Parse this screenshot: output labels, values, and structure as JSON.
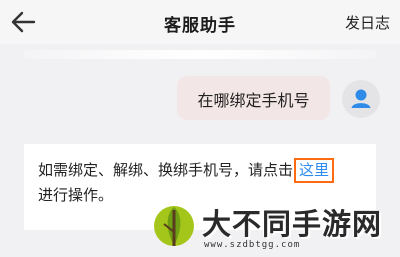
{
  "header": {
    "back_icon": "arrow-left-icon",
    "title": "客服助手",
    "log_button": "发日志"
  },
  "chat": {
    "user_message": "在哪绑定手机号",
    "user_avatar_icon": "person-icon",
    "bot_message_before_link": "如需绑定、解绑、换绑手机号，请点击",
    "bot_link": "这里",
    "bot_message_after_link": "进行操作。"
  },
  "watermark": {
    "brand": "大不同手游网",
    "url": "www.szdbtgg.com"
  },
  "colors": {
    "link": "#2d8cf0",
    "highlight_box": "#ff6a13",
    "user_bubble": "#f3e6e6"
  }
}
